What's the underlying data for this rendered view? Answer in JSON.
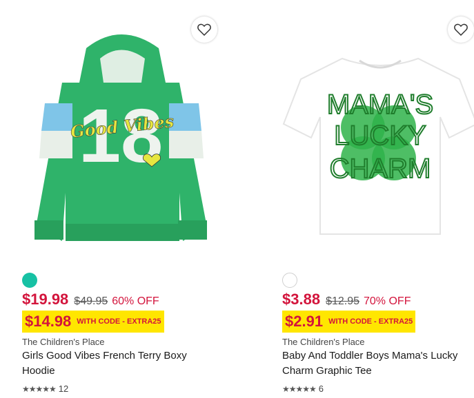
{
  "products": [
    {
      "color": "#17c1a4",
      "price": "$19.98",
      "original_price": "$49.95",
      "discount": "60% OFF",
      "promo_price": "$14.98",
      "promo_code": "WITH CODE - EXTRA25",
      "brand": "The Children's Place",
      "name": "Girls Good Vibes French Terry Boxy Hoodie",
      "stars": "★★★★★",
      "reviews": "12",
      "graphic_text": "Good Vibes",
      "graphic_number": "18"
    },
    {
      "color": "#ffffff",
      "price": "$3.88",
      "original_price": "$12.95",
      "discount": "70% OFF",
      "promo_price": "$2.91",
      "promo_code": "WITH CODE - EXTRA25",
      "brand": "The Children's Place",
      "name": "Baby And Toddler Boys Mama's Lucky Charm Graphic Tee",
      "stars": "★★★★★",
      "reviews": "6",
      "graphic_lines": [
        "MAMA'S",
        "LUCKY",
        "CHARM"
      ]
    }
  ]
}
